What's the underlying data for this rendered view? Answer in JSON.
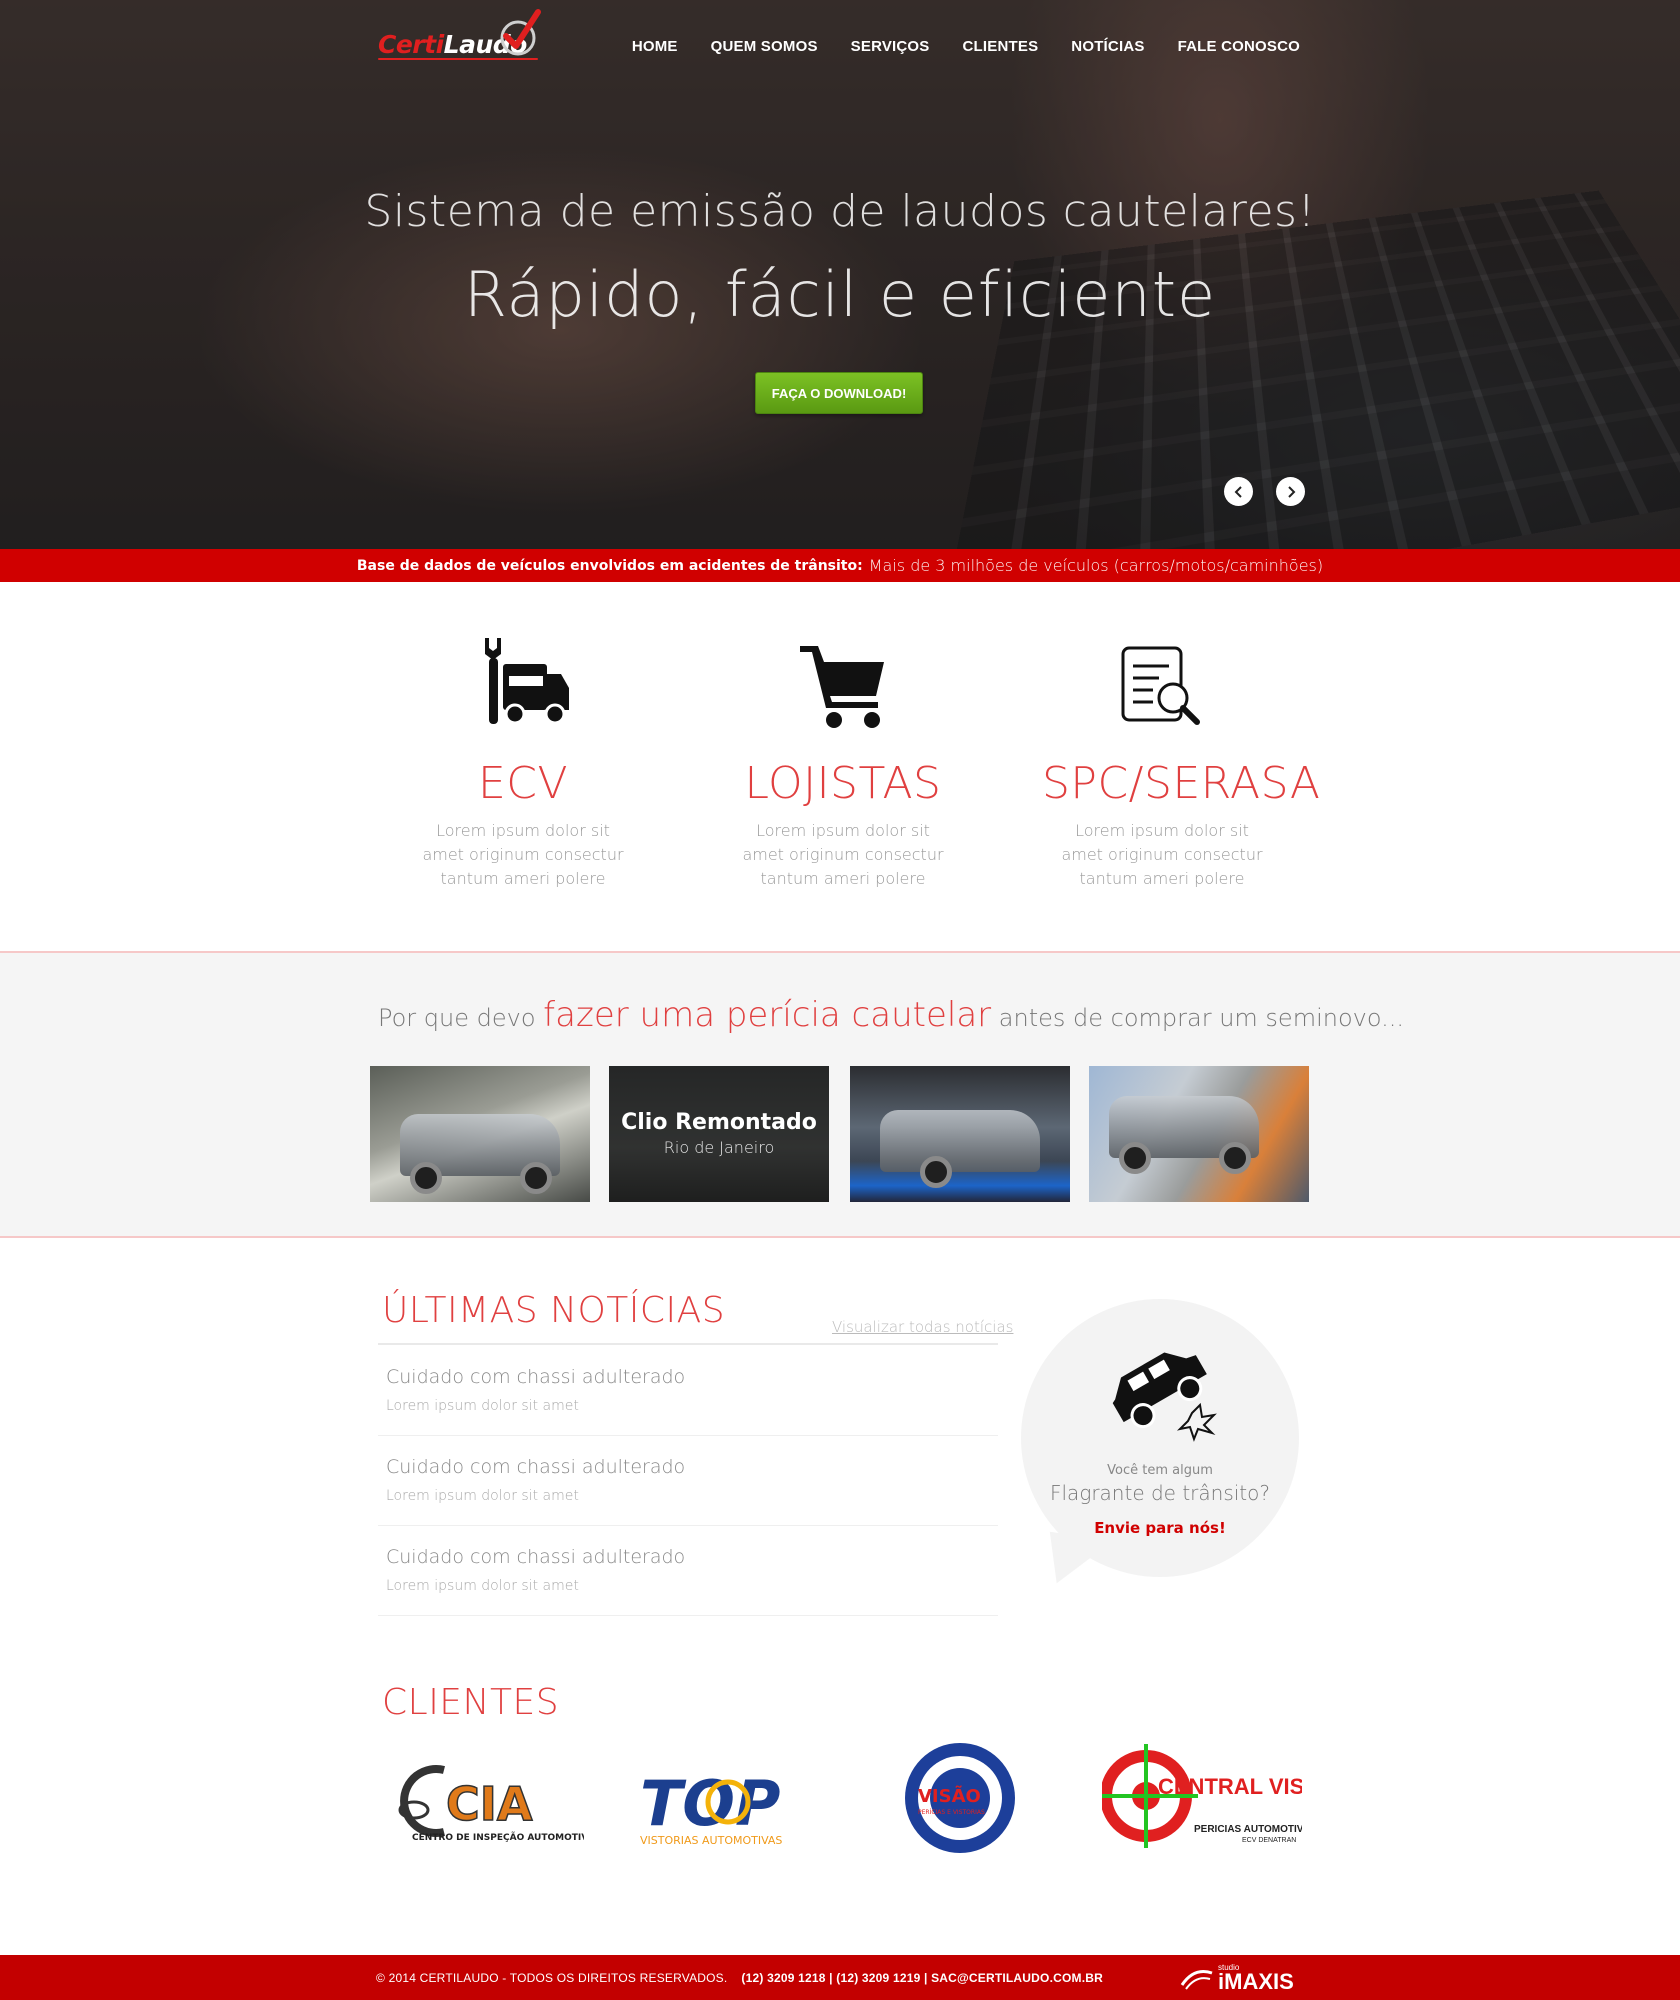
{
  "brand": {
    "logo_part1": "Certi",
    "logo_part2": "Laudo"
  },
  "nav": {
    "items": [
      "HOME",
      "QUEM SOMOS",
      "SERVIÇOS",
      "CLIENTES",
      "NOTÍCIAS",
      "FALE CONOSCO"
    ]
  },
  "hero": {
    "line1": "Sistema de emissão de laudos cautelares!",
    "line2": "Rápido, fácil e eficiente",
    "cta": "FAÇA O DOWNLOAD!",
    "prev_icon": "chevron-left-icon",
    "next_icon": "chevron-right-icon"
  },
  "banner": {
    "label": "Base de dados de veículos envolvidos em acidentes de trânsito:",
    "value": "Mais de 3 milhões de veículos (carros/motos/caminhões)"
  },
  "services": [
    {
      "icon": "wrench-truck-icon",
      "title": "ECV",
      "desc": "Lorem ipsum dolor sit amet originum consectur tantum ameri polere"
    },
    {
      "icon": "shopping-cart-icon",
      "title": "LOJISTAS",
      "desc": "Lorem ipsum dolor sit amet originum consectur tantum ameri polere"
    },
    {
      "icon": "document-search-icon",
      "title": "SPC/SERASA",
      "desc": "Lorem ipsum dolor sit amet originum consectur tantum ameri polere"
    }
  ],
  "why": {
    "pre": "Por que devo",
    "highlight": "fazer uma perícia cautelar",
    "post": "antes de comprar um seminovo...",
    "gallery": [
      {
        "caption_title": "",
        "caption_sub": ""
      },
      {
        "caption_title": "Clio Remontado",
        "caption_sub": "Rio de Janeiro"
      },
      {
        "caption_title": "",
        "caption_sub": ""
      },
      {
        "caption_title": "",
        "caption_sub": ""
      }
    ]
  },
  "news": {
    "title": "ÚLTIMAS NOTÍCIAS",
    "view_all": "Visualizar todas notícias",
    "items": [
      {
        "title": "Cuidado com chassi adulterado",
        "summary": "Lorem ipsum dolor sit amet"
      },
      {
        "title": "Cuidado com chassi adulterado",
        "summary": "Lorem ipsum dolor sit amet"
      },
      {
        "title": "Cuidado com chassi adulterado",
        "summary": "Lorem ipsum dolor sit amet"
      }
    ]
  },
  "flagrante": {
    "icon": "crashed-car-icon",
    "line1": "Você tem algum",
    "line2": "Flagrante de trânsito?",
    "cta": "Envie para nós!"
  },
  "clients": {
    "title": "CLIENTES",
    "logos": [
      {
        "name": "CIA",
        "sub": "CENTRO DE INSPEÇÃO AUTOMOTIVA"
      },
      {
        "name": "TOP",
        "sub": "VISTORIAS AUTOMOTIVAS"
      },
      {
        "name": "VISÃO",
        "sub": "PERÍCIAS E VISTORIAS"
      },
      {
        "name": "CENTRAL VISTORIAS",
        "sub": "PERICIAS AUTOMOTIVAS",
        "tag": "ECV DENATRAN"
      }
    ]
  },
  "footer": {
    "copyright": "© 2014 CERTILAUDO - TODOS OS DIREITOS RESERVADOS.",
    "contact": "(12) 3209 1218 | (12) 3209 1219 | SAC@CERTILAUDO.COM.BR",
    "studio_small": "studio",
    "studio_name": "iMAXIS"
  },
  "colors": {
    "accent_red": "#d00000",
    "title_red": "#e04040",
    "cta_green": "#6cb01c"
  }
}
